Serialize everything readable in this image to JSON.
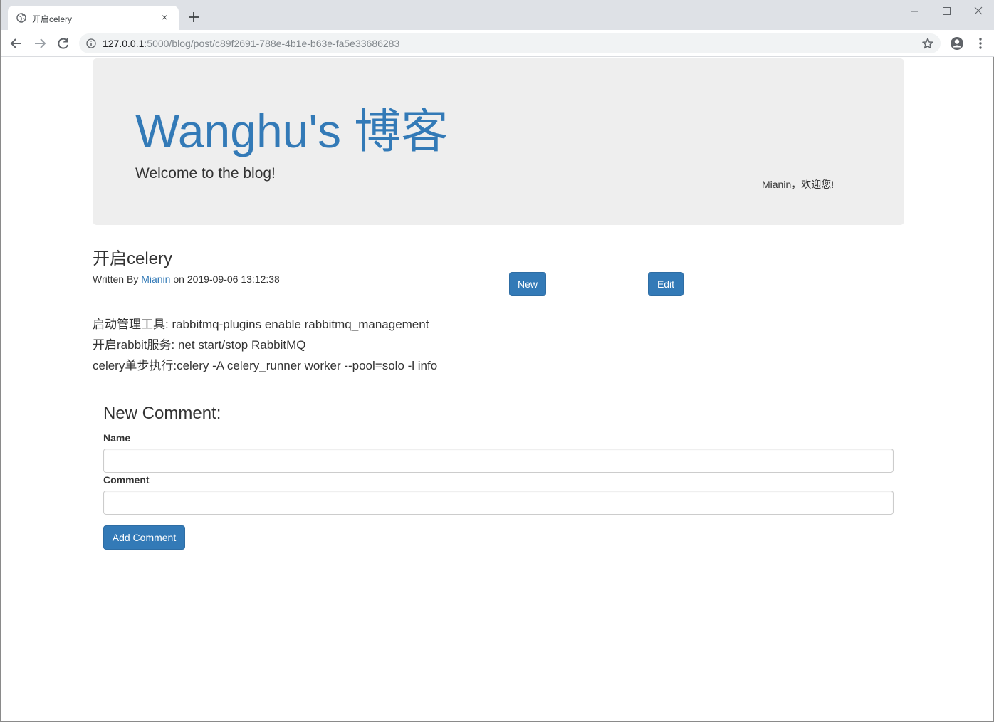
{
  "browser": {
    "tab_title": "开启celery",
    "new_tab_label": "+",
    "tab_close_label": "×",
    "url_host": "127.0.0.1",
    "url_rest": ":5000/blog/post/c89f2691-788e-4b1e-b63e-fa5e33686283"
  },
  "header": {
    "site_title": "Wanghu's 博客",
    "subtitle": "Welcome to the blog!",
    "welcome_text": "Mianin，欢迎您!"
  },
  "post": {
    "title": "开启celery",
    "byline_prefix": "Written By ",
    "author": "Mianin",
    "byline_mid": " on ",
    "timestamp": "2019-09-06 13:12:38",
    "new_label": "New",
    "edit_label": "Edit",
    "lines": [
      "启动管理工具: rabbitmq-plugins enable rabbitmq_management",
      "开启rabbit服务: net start/stop RabbitMQ",
      "celery单步执行:celery -A celery_runner worker --pool=solo -l info"
    ]
  },
  "comment_form": {
    "heading": "New Comment:",
    "name_label": "Name",
    "name_value": "",
    "comment_label": "Comment",
    "comment_value": "",
    "submit_label": "Add Comment"
  },
  "colors": {
    "link": "#337ab7",
    "button": "#337ab7",
    "jumbotron_bg": "#eeeeee"
  }
}
